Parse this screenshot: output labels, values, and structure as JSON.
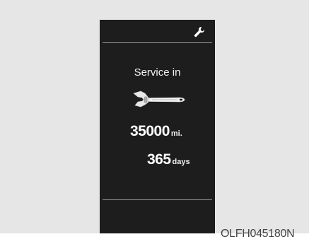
{
  "display": {
    "header_icon": "wrench-icon",
    "title": "Service in",
    "center_icon": "adjustable-wrench-icon",
    "distance_value": "35000",
    "distance_unit": "mi.",
    "days_value": "365",
    "days_unit": "days"
  },
  "figure": {
    "code": "OLFH045180N"
  },
  "colors": {
    "screen_background": "#1d1d1d",
    "page_background": "#e6e6e6",
    "text": "#ffffff",
    "divider": "#9a9a9a"
  }
}
